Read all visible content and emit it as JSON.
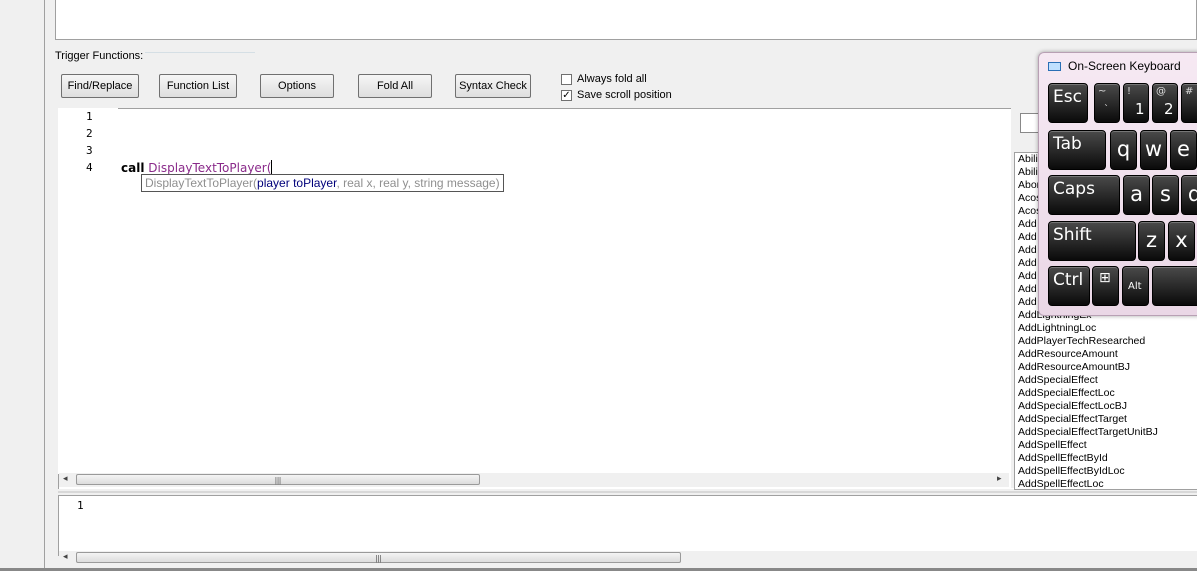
{
  "group": {
    "label": "Trigger Functions:"
  },
  "toolbar": {
    "find_replace": "Find/Replace",
    "function_list": "Function List",
    "options": "Options",
    "fold_all": "Fold All",
    "syntax_check": "Syntax Check"
  },
  "checkboxes": {
    "always_fold": {
      "label": "Always fold all",
      "checked": false
    },
    "save_scroll": {
      "label": "Save scroll position",
      "checked": true,
      "mark": "✓"
    }
  },
  "editor": {
    "line_numbers": [
      "1",
      "2",
      "3",
      "4"
    ],
    "code_keyword": "call",
    "code_function": "DisplayTextToPlayer(",
    "tooltip": {
      "prefix": "DisplayTextToPlayer(",
      "current_param": "player toPlayer",
      "rest": ", real x, real y, string message)"
    }
  },
  "output": {
    "line_numbers": [
      "1"
    ]
  },
  "function_list": {
    "items": [
      "Abili",
      "Abili",
      "Abor",
      "Acos",
      "Acos",
      "Add",
      "Add",
      "Add",
      "Add",
      "Add",
      "Add",
      "Add",
      "AddLightningEx",
      "AddLightningLoc",
      "AddPlayerTechResearched",
      "AddResourceAmount",
      "AddResourceAmountBJ",
      "AddSpecialEffect",
      "AddSpecialEffectLoc",
      "AddSpecialEffectLocBJ",
      "AddSpecialEffectTarget",
      "AddSpecialEffectTargetUnitBJ",
      "AddSpellEffect",
      "AddSpellEffectById",
      "AddSpellEffectByIdLoc",
      "AddSpellEffectLoc"
    ]
  },
  "osk": {
    "title": "On-Screen Keyboard",
    "keys": {
      "esc": "Esc",
      "tilde_top": "~",
      "tilde_bottom": "`",
      "one_top": "!",
      "one_bottom": "1",
      "two_top": "@",
      "two_bottom": "2",
      "three_top": "#",
      "tab": "Tab",
      "q": "q",
      "w": "w",
      "e": "e",
      "caps": "Caps",
      "a": "a",
      "s": "s",
      "d": "d",
      "shift": "Shift",
      "z": "z",
      "x": "x",
      "ctrl": "Ctrl",
      "win": "⊞",
      "alt": "Alt"
    }
  },
  "scrollbar": {
    "grip": "|||",
    "left_arrow": "◂",
    "right_arrow": "▸"
  }
}
